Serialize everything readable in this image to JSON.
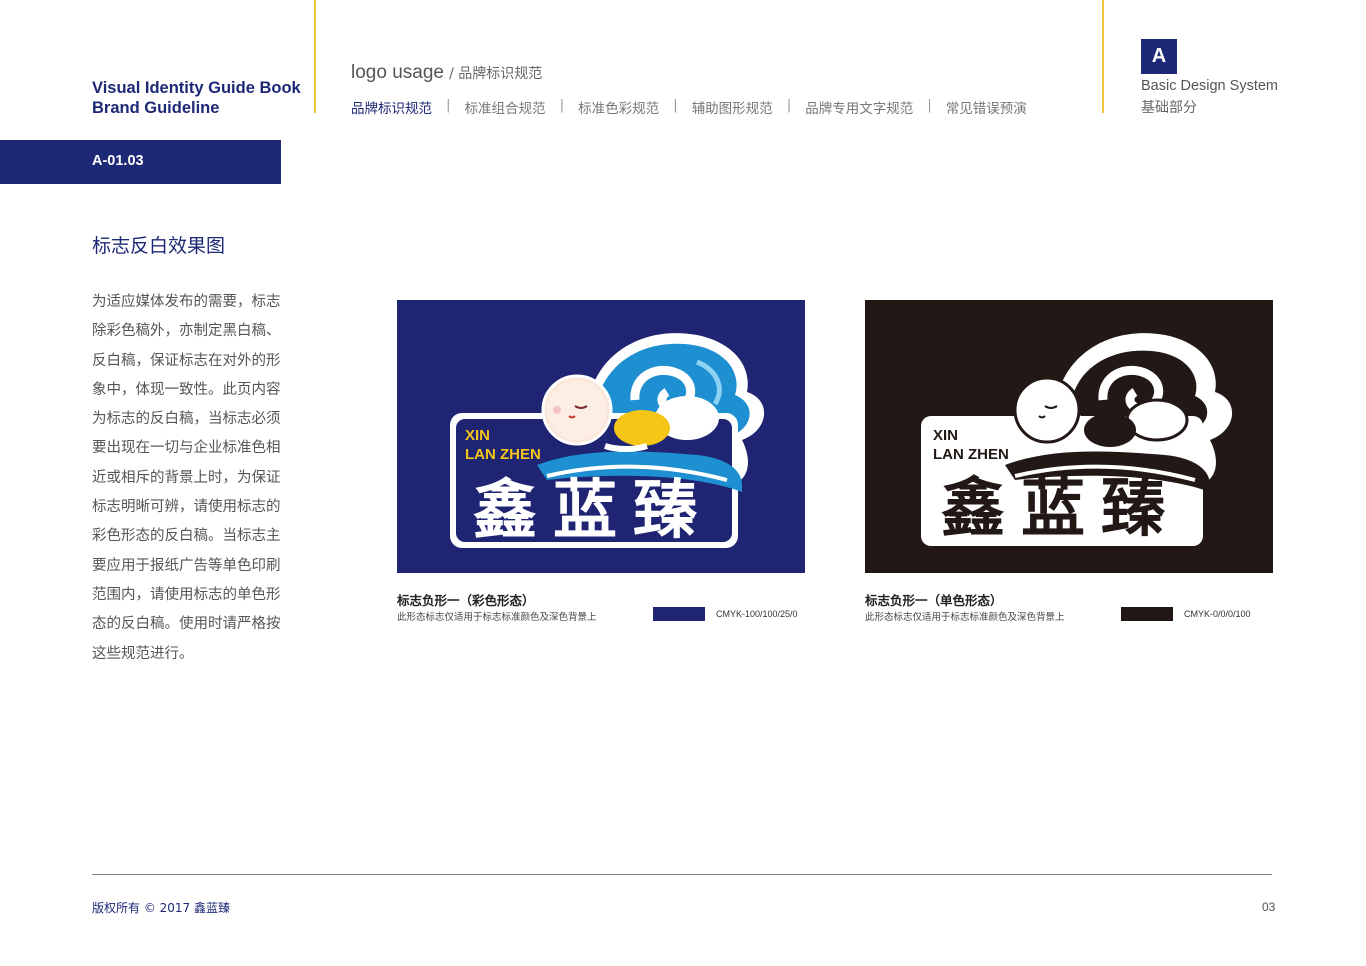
{
  "header": {
    "guide_title_line1": "Visual Identity Guide Book",
    "guide_title_line2": "Brand Guideline",
    "usage_title_en": "logo usage",
    "usage_title_cn": "/ 品牌标识规范",
    "nav": [
      {
        "label": "品牌标识规范",
        "active": true
      },
      {
        "label": "标准组合规范",
        "active": false
      },
      {
        "label": "标准色彩规范",
        "active": false
      },
      {
        "label": "辅助图形规范",
        "active": false
      },
      {
        "label": "品牌专用文字规范",
        "active": false
      },
      {
        "label": "常见错误预演",
        "active": false
      }
    ],
    "nav_separator": "|",
    "section_letter": "A",
    "section_en": "Basic Design System",
    "section_cn": "基础部分"
  },
  "page_code": "A-01.03",
  "page_heading": "标志反白效果图",
  "description": "为适应媒体发布的需要，标志除彩色稿外，亦制定黑白稿、反白稿，保证标志在对外的形象中，体现一致性。此页内容为标志的反白稿，当标志必须要出现在一切与企业标准色相近或相斥的背景上时，为保证标志明晰可辨，请使用标志的彩色形态的反白稿。当标志主要应用于报纸广告等单色印刷范围内，请使用标志的单色形态的反白稿。使用时请严格按这些规范进行。",
  "logo": {
    "pinyin_line1": "XIN",
    "pinyin_line2": "LAN ZHEN",
    "chinese_name": "鑫蓝臻"
  },
  "variants": [
    {
      "title": "标志负形一（彩色形态）",
      "note": "此形态标志仅适用于标志标准颜色及深色背景上",
      "cmyk": "CMYK-100/100/25/0",
      "color": "#1f2473"
    },
    {
      "title": "标志负形一（单色形态）",
      "note": "此形态标志仅适用于标志标准颜色及深色背景上",
      "cmyk": "CMYK-0/0/0/100",
      "color": "#221815"
    }
  ],
  "footer": {
    "copyright": "版权所有 ©  2017  鑫蓝臻",
    "page_number": "03"
  },
  "colors": {
    "brand_navy": "#1d2876",
    "accent_yellow": "#f0c53a",
    "wave_blue": "#1e8fd0",
    "pinyin_yellow": "#f5c518"
  }
}
